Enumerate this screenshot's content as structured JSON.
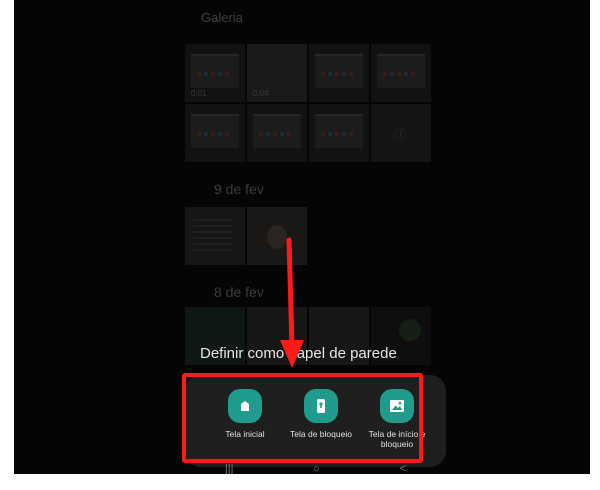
{
  "gallery": {
    "title": "Galeria"
  },
  "sections": [
    {
      "date": "",
      "thumbs": [
        "slide",
        "light",
        "slide",
        "slide",
        "slide",
        "slide",
        "slide",
        "empty"
      ]
    },
    {
      "date": "9 de fev",
      "thumbs": [
        "paper",
        "person"
      ]
    },
    {
      "date": "8 de fev",
      "thumbs": [
        "green",
        "doc",
        "doc",
        "dark"
      ]
    }
  ],
  "videos": {
    "duration_1": "0:01",
    "duration_2": "0:04"
  },
  "sheet": {
    "title": "Definir como papel de parede",
    "options": [
      {
        "label": "Tela inicial",
        "icon": "home-icon"
      },
      {
        "label": "Tela de bloqueio",
        "icon": "lock-icon"
      },
      {
        "label": "Tela de início e bloqueio",
        "icon": "image-icon"
      }
    ]
  },
  "nav": {
    "recents": "|||",
    "home": "○",
    "back": "<"
  },
  "colors": {
    "accent": "#1f9c8e",
    "highlight": "#ff1a1a",
    "background": "#050505",
    "sheet": "#1f1f1f"
  }
}
